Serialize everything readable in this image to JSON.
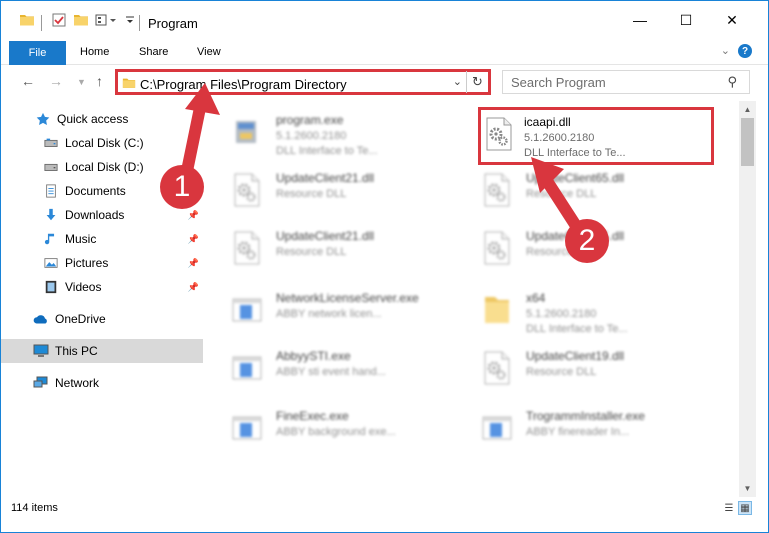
{
  "window": {
    "title": "Program",
    "accent": "#1979ca",
    "highlight": "#d9363e"
  },
  "quick_access_toolbar": {
    "icons": [
      "folder-icon",
      "properties-check-icon",
      "new-folder-icon",
      "customize-icon"
    ]
  },
  "window_controls": {
    "minimize": "—",
    "maximize": "☐",
    "close": "✕"
  },
  "ribbon": {
    "file_label": "File",
    "tabs": [
      "Home",
      "Share",
      "View"
    ],
    "help": "?"
  },
  "navigation": {
    "address_path": "C:\\Program Files\\Program Directory",
    "search_placeholder": "Search Program"
  },
  "sidebar": {
    "items": [
      {
        "label": "Quick access",
        "icon": "star-icon",
        "pinned": false
      },
      {
        "label": "Local Disk (C:)",
        "icon": "drive-icon",
        "pinned": false
      },
      {
        "label": "Local Disk (D:)",
        "icon": "drive-icon",
        "pinned": false
      },
      {
        "label": "Documents",
        "icon": "documents-icon",
        "pinned": false
      },
      {
        "label": "Downloads",
        "icon": "download-icon",
        "pinned": true
      },
      {
        "label": "Music",
        "icon": "music-icon",
        "pinned": true
      },
      {
        "label": "Pictures",
        "icon": "pictures-icon",
        "pinned": true
      },
      {
        "label": "Videos",
        "icon": "video-icon",
        "pinned": true
      },
      {
        "label": "OneDrive",
        "icon": "cloud-icon",
        "pinned": false
      },
      {
        "label": "This PC",
        "icon": "computer-icon",
        "pinned": false,
        "selected": true
      },
      {
        "label": "Network",
        "icon": "network-icon",
        "pinned": false
      }
    ]
  },
  "files": [
    {
      "name": "program.exe",
      "line2": "5.1.2600.2180",
      "line3": "DLL Interface to Te...",
      "type": "exe-icon",
      "blur": true
    },
    {
      "name": "icaapi.dll",
      "line2": "5.1.2600.2180",
      "line3": "DLL Interface to Te...",
      "type": "dll-gear-icon",
      "blur": false,
      "highlighted": true
    },
    {
      "name": "UpdateClient21.dll",
      "line2": "Resource DLL",
      "line3": "",
      "type": "dll-gear-icon",
      "blur": true
    },
    {
      "name": "UpdateClient65.dll",
      "line2": "Resource DLL",
      "line3": "",
      "type": "dll-gear-icon",
      "blur": true
    },
    {
      "name": "UpdateClient21.dll",
      "line2": "Resource DLL",
      "line3": "",
      "type": "dll-gear-icon",
      "blur": true
    },
    {
      "name": "UpdateClient65.dll",
      "line2": "Resource DLL",
      "line3": "",
      "type": "dll-gear-icon",
      "blur": true
    },
    {
      "name": "NetworkLicenseServer.exe",
      "line2": "ABBY network licen...",
      "line3": "",
      "type": "app-window-icon",
      "blur": true
    },
    {
      "name": "x64",
      "line2": "5.1.2600.2180",
      "line3": "DLL Interface to Te...",
      "type": "folder-icon",
      "blur": true
    },
    {
      "name": "AbbyySTI.exe",
      "line2": "ABBY sti event hand...",
      "line3": "",
      "type": "app-window-icon",
      "blur": true
    },
    {
      "name": "UpdateClient19.dll",
      "line2": "Resource DLL",
      "line3": "",
      "type": "dll-gear-icon",
      "blur": true
    },
    {
      "name": "FineExec.exe",
      "line2": "ABBY background exe...",
      "line3": "",
      "type": "app-window-icon",
      "blur": true
    },
    {
      "name": "TrogrammInstaller.exe",
      "line2": "ABBY finereader In...",
      "line3": "",
      "type": "app-window-icon",
      "blur": true
    }
  ],
  "status": {
    "item_count": "114 items"
  },
  "annotations": {
    "step1": "1",
    "step2": "2"
  }
}
